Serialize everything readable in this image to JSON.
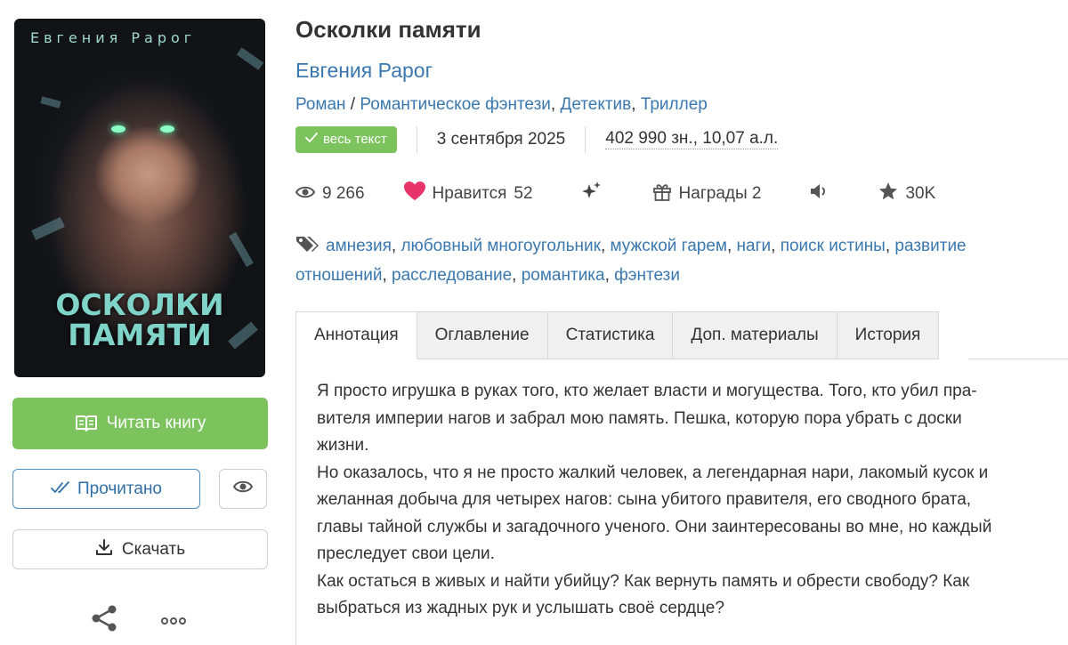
{
  "cover": {
    "author_text": "Евгения Рарог",
    "title_line1": "ОСКОЛКИ",
    "title_line2": "ПАМЯТИ"
  },
  "actions": {
    "read_label": "Читать книгу",
    "read_done_label": "Прочитано",
    "download_label": "Скачать"
  },
  "book": {
    "title": "Осколки памяти",
    "author": "Евгения Рарог",
    "genre_main": "Роман",
    "genre_sep": " / ",
    "genres": [
      "Романтическое фэнтези",
      "Детектив",
      "Триллер"
    ],
    "status_badge": "весь текст",
    "date": "3 сентября 2025",
    "size": "402 990 зн., 10,07 а.л."
  },
  "stats": {
    "views": "9 266",
    "likes_label": "Нравится",
    "likes_count": "52",
    "awards_label": "Награды 2",
    "rating": "30K"
  },
  "tags": [
    "амнезия",
    "любовный многоугольник",
    "мужской гарем",
    "наги",
    "поиск истины",
    "развитие отношений",
    "расследование",
    "романтика",
    "фэнтези"
  ],
  "tabs": [
    "Аннотация",
    "Оглавление",
    "Статистика",
    "Доп. материалы",
    "История"
  ],
  "annotation": {
    "lines": [
      "Я просто игрушка в руках того, кто желает власти и могущества. Того, кто убил пра-",
      "вителя империи нагов и забрал мою память. Пешка, которую пора убрать с доски",
      "жизни.",
      "Но оказалось, что я не просто жалкий человек, а легендарная нари, лакомый кусок и",
      "желанная добыча для четырех нагов: сына убитого правителя, его сводного брата,",
      "главы тайной службы и загадочного ученого. Они заинтересованы во мне, но каждый",
      "преследует свои цели.",
      "Как остаться в живых и найти убийцу? Как вернуть память и обрести свободу? Как",
      "выбраться из жадных рук и услышать своё сердце?"
    ]
  },
  "colors": {
    "accent_green": "#7cc35d",
    "link_blue": "#3a78b0",
    "heart_pink": "#e8336b"
  }
}
